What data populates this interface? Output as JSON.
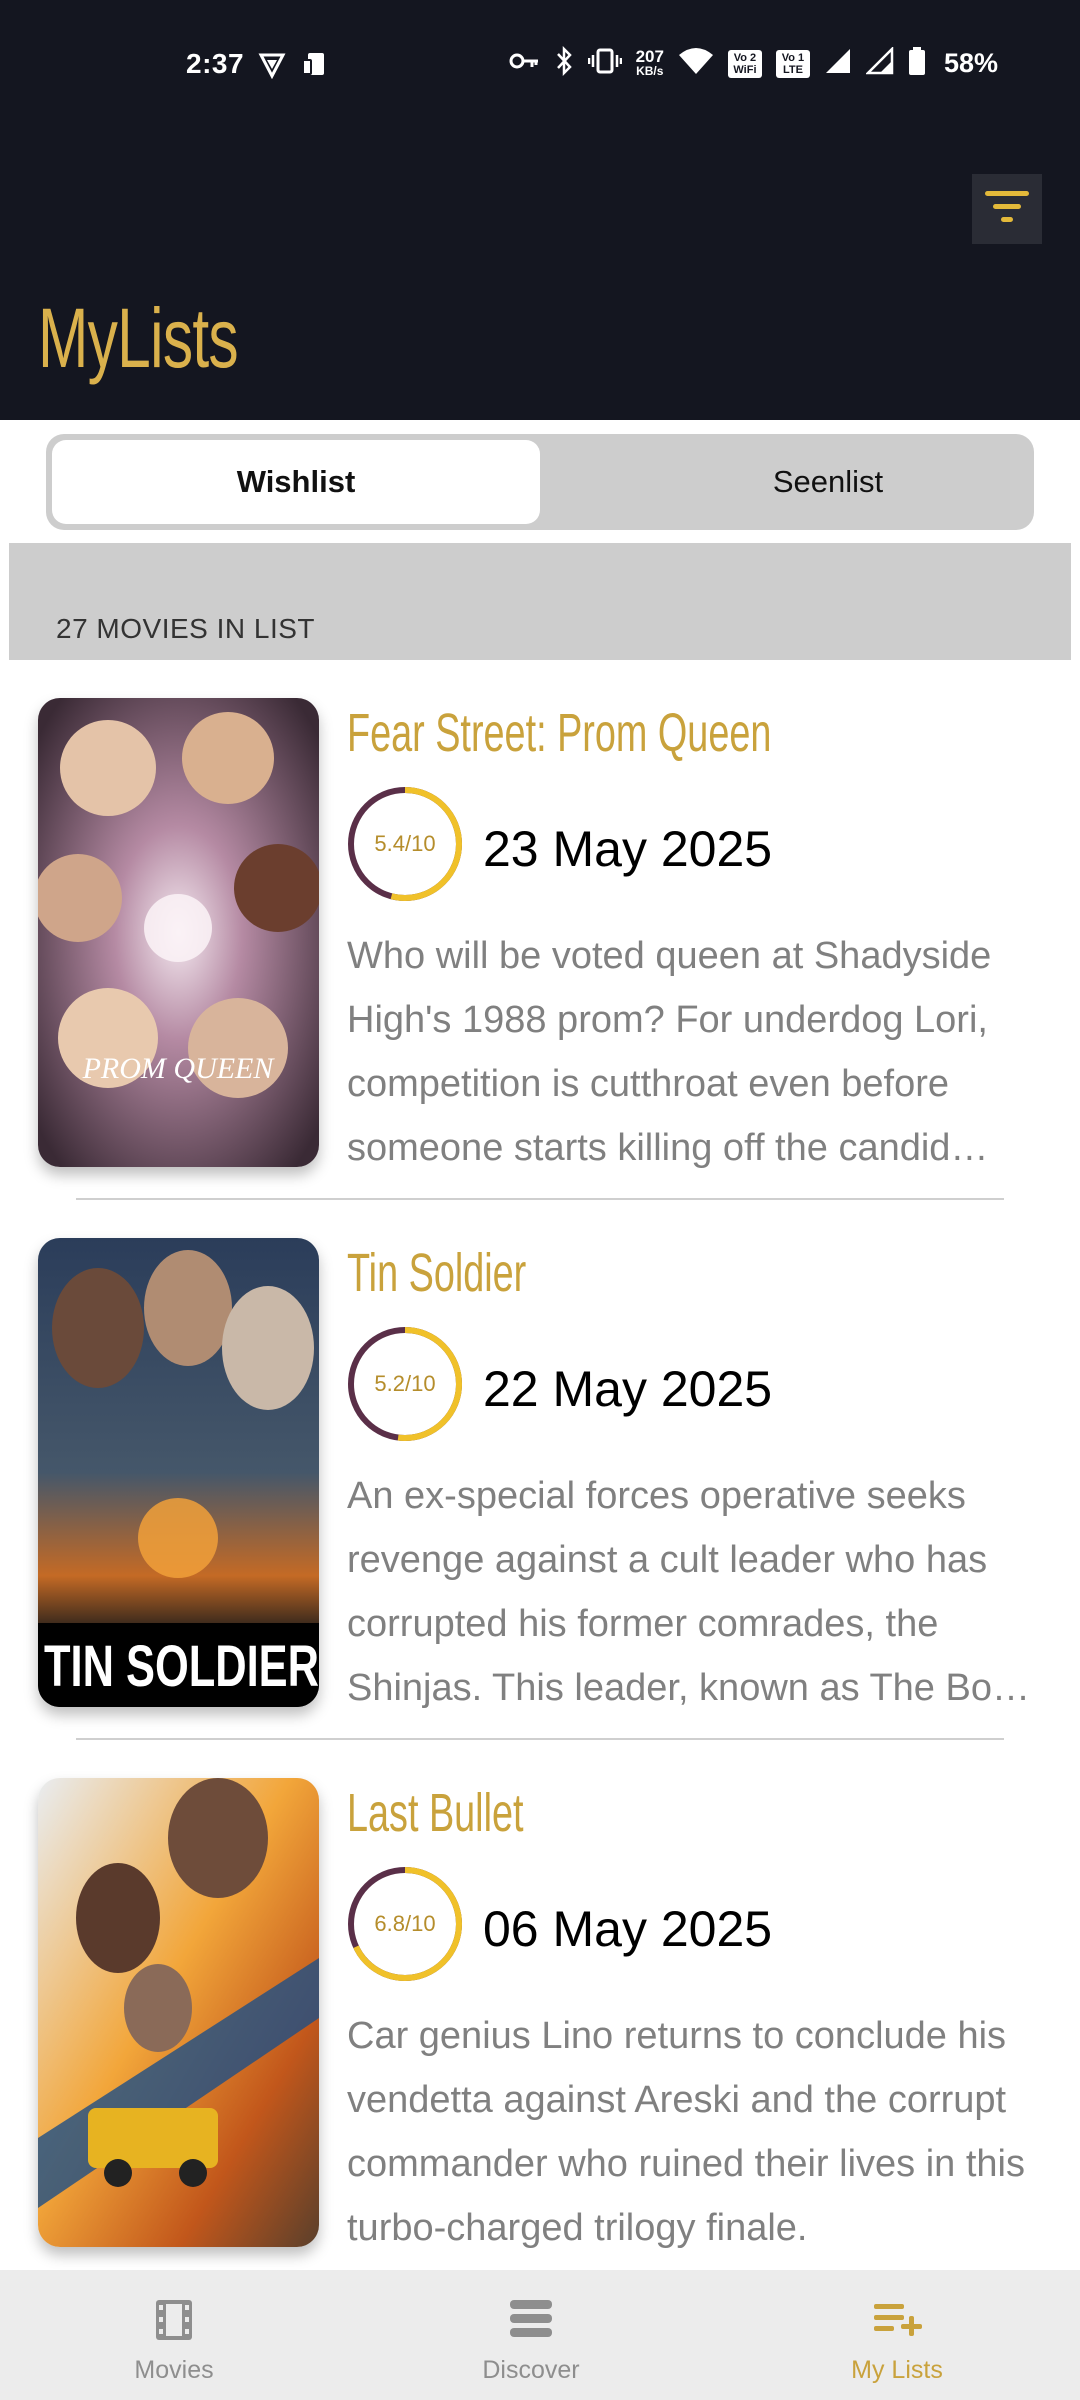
{
  "status_bar": {
    "time": "2:37",
    "net_speed_value": "207",
    "net_speed_unit": "KB/s",
    "vowifi_label": "Vo 2 WiFi",
    "volte_label": "Vo 1 LTE",
    "battery_percent": "58%",
    "icons": [
      "vpn-shield-icon",
      "device-icon",
      "key-icon",
      "bluetooth-icon",
      "vibrate-icon",
      "wifi-icon",
      "signal-icon",
      "signal-icon",
      "battery-icon"
    ]
  },
  "header": {
    "title": "MyLists",
    "filter_icon": "filter-icon"
  },
  "tabs": {
    "items": [
      {
        "label": "Wishlist",
        "active": true
      },
      {
        "label": "Seenlist",
        "active": false
      }
    ]
  },
  "list": {
    "count_label": "27 MOVIES IN LIST",
    "movies": [
      {
        "title": "Fear Street: Prom Queen",
        "rating_label": "5.4/10",
        "rating": 5.4,
        "date": "23 May 2025",
        "overview": "Who will be voted queen at Shadyside High's 1988 prom? For underdog Lori, competition is cutthroat even before someone starts killing off the candid…",
        "poster_text": "PROM QUEEN"
      },
      {
        "title": "Tin Soldier",
        "rating_label": "5.2/10",
        "rating": 5.2,
        "date": "22 May 2025",
        "overview": "An ex-special forces operative seeks revenge against a cult leader who has corrupted his former comrades, the Shinjas. This leader, known as The Bo…",
        "poster_text": "TIN SOLDIER"
      },
      {
        "title": "Last Bullet",
        "rating_label": "6.8/10",
        "rating": 6.8,
        "date": "06 May 2025",
        "overview": "Car genius Lino returns to conclude his vendetta against Areski and the corrupt commander who ruined their lives in this turbo-charged trilogy finale.",
        "poster_text": ""
      }
    ]
  },
  "bottom_nav": {
    "items": [
      {
        "label": "Movies",
        "icon": "film-icon",
        "active": false
      },
      {
        "label": "Discover",
        "icon": "discover-icon",
        "active": false
      },
      {
        "label": "My Lists",
        "icon": "playlist-add-icon",
        "active": true
      }
    ]
  },
  "colors": {
    "header_bg": "#141620",
    "accent_gold": "#dab14c",
    "ring_gold": "#f0c12a",
    "ring_purple": "#5a2f48",
    "overview_gray": "#808080"
  }
}
